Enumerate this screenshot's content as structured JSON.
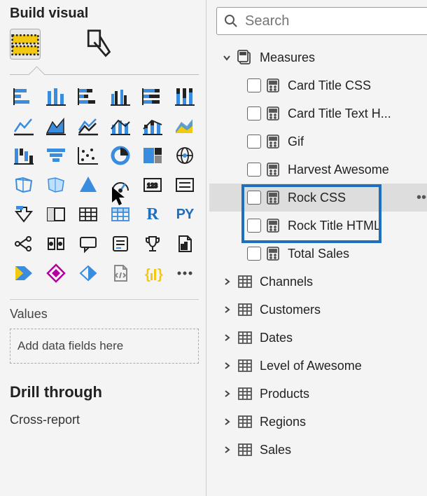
{
  "build": {
    "title": "Build visual",
    "values_label": "Values",
    "dropzone": "Add data fields here",
    "drill_title": "Drill through",
    "cross_report": "Cross-report"
  },
  "search": {
    "placeholder": "Search"
  },
  "tree": {
    "measures": {
      "label": "Measures",
      "items": [
        {
          "label": "Card Title CSS"
        },
        {
          "label": "Card Title Text H..."
        },
        {
          "label": "Gif"
        },
        {
          "label": "Harvest Awesome"
        },
        {
          "label": "Rock CSS"
        },
        {
          "label": "Rock Title HTML"
        },
        {
          "label": "Total Sales"
        }
      ]
    },
    "tables": [
      {
        "label": "Channels"
      },
      {
        "label": "Customers"
      },
      {
        "label": "Dates"
      },
      {
        "label": "Level of Awesome"
      },
      {
        "label": "Products"
      },
      {
        "label": "Regions"
      },
      {
        "label": "Sales"
      }
    ]
  },
  "viz_icons": [
    "stacked-bar",
    "clustered-bar",
    "stacked-column",
    "clustered-column",
    "100-stacked-bar",
    "100-stacked-column",
    "line",
    "area",
    "stacked-area",
    "line-clustered",
    "line-stacked",
    "ribbon",
    "waterfall",
    "funnel",
    "scatter",
    "pie",
    "treemap",
    "map-globe",
    "filled-map",
    "shape-map",
    "arcgis",
    "gauge",
    "card",
    "multi-row-card",
    "kpi",
    "slicer",
    "table",
    "matrix",
    "r-visual",
    "python-visual",
    "decomposition-tree",
    "key-influencers",
    "qa",
    "smart-narrative",
    "goals",
    "paginated-report",
    "power-automate",
    "power-apps",
    "custom-visual",
    "html-content",
    "deneb",
    "get-more"
  ]
}
